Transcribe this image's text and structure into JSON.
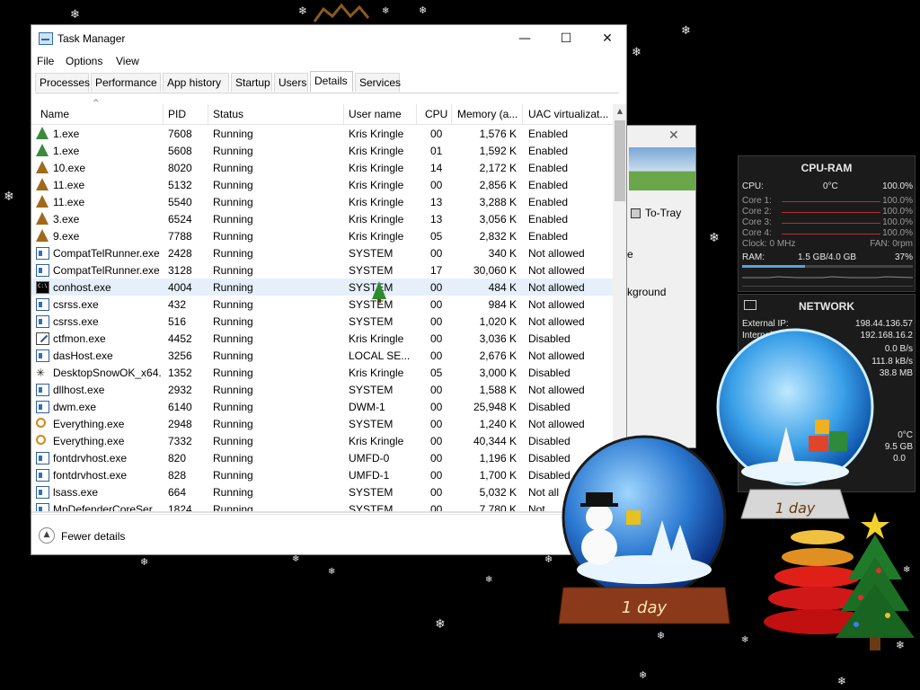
{
  "window": {
    "title": "Task Manager",
    "controls": {
      "minimize": "—",
      "maximize": "☐",
      "close": "✕"
    }
  },
  "menu": [
    "File",
    "Options",
    "View"
  ],
  "tabs": [
    "Processes",
    "Performance",
    "App history",
    "Startup",
    "Users",
    "Details",
    "Services"
  ],
  "active_tab": "Details",
  "columns": [
    "Name",
    "PID",
    "Status",
    "User name",
    "CPU",
    "Memory (a...",
    "UAC virtualizat..."
  ],
  "rows": [
    {
      "icon": "tree-icon",
      "name": "1.exe",
      "pid": "7608",
      "status": "Running",
      "user": "Kris Kringle",
      "cpu": "00",
      "mem": "1,576 K",
      "uac": "Enabled"
    },
    {
      "icon": "tree-icon",
      "name": "1.exe",
      "pid": "5608",
      "status": "Running",
      "user": "Kris Kringle",
      "cpu": "01",
      "mem": "1,592 K",
      "uac": "Enabled"
    },
    {
      "icon": "tree-brown-icon",
      "name": "10.exe",
      "pid": "8020",
      "status": "Running",
      "user": "Kris Kringle",
      "cpu": "14",
      "mem": "2,172 K",
      "uac": "Enabled"
    },
    {
      "icon": "tree-brown-icon",
      "name": "11.exe",
      "pid": "5132",
      "status": "Running",
      "user": "Kris Kringle",
      "cpu": "00",
      "mem": "2,856 K",
      "uac": "Enabled"
    },
    {
      "icon": "tree-brown-icon",
      "name": "11.exe",
      "pid": "5540",
      "status": "Running",
      "user": "Kris Kringle",
      "cpu": "13",
      "mem": "3,288 K",
      "uac": "Enabled"
    },
    {
      "icon": "tree-brown-icon",
      "name": "3.exe",
      "pid": "6524",
      "status": "Running",
      "user": "Kris Kringle",
      "cpu": "13",
      "mem": "3,056 K",
      "uac": "Enabled"
    },
    {
      "icon": "tree-brown-icon",
      "name": "9.exe",
      "pid": "7788",
      "status": "Running",
      "user": "Kris Kringle",
      "cpu": "05",
      "mem": "2,832 K",
      "uac": "Enabled"
    },
    {
      "icon": "app-icon",
      "name": "CompatTelRunner.exe",
      "pid": "2428",
      "status": "Running",
      "user": "SYSTEM",
      "cpu": "00",
      "mem": "340 K",
      "uac": "Not allowed"
    },
    {
      "icon": "app-icon",
      "name": "CompatTelRunner.exe",
      "pid": "3128",
      "status": "Running",
      "user": "SYSTEM",
      "cpu": "17",
      "mem": "30,060 K",
      "uac": "Not allowed"
    },
    {
      "icon": "console-icon",
      "name": "conhost.exe",
      "pid": "4004",
      "status": "Running",
      "user": "SYSTEM",
      "cpu": "00",
      "mem": "484 K",
      "uac": "Not allowed",
      "selected": true
    },
    {
      "icon": "app-icon",
      "name": "csrss.exe",
      "pid": "432",
      "status": "Running",
      "user": "SYSTEM",
      "cpu": "00",
      "mem": "984 K",
      "uac": "Not allowed"
    },
    {
      "icon": "app-icon",
      "name": "csrss.exe",
      "pid": "516",
      "status": "Running",
      "user": "SYSTEM",
      "cpu": "00",
      "mem": "1,020 K",
      "uac": "Not allowed"
    },
    {
      "icon": "pen-icon",
      "name": "ctfmon.exe",
      "pid": "4452",
      "status": "Running",
      "user": "Kris Kringle",
      "cpu": "00",
      "mem": "3,036 K",
      "uac": "Disabled"
    },
    {
      "icon": "app-icon",
      "name": "dasHost.exe",
      "pid": "3256",
      "status": "Running",
      "user": "LOCAL SE...",
      "cpu": "00",
      "mem": "2,676 K",
      "uac": "Not allowed"
    },
    {
      "icon": "snowflake-icon",
      "name": "DesktopSnowOK_x64...",
      "pid": "1352",
      "status": "Running",
      "user": "Kris Kringle",
      "cpu": "05",
      "mem": "3,000 K",
      "uac": "Disabled"
    },
    {
      "icon": "app-icon",
      "name": "dllhost.exe",
      "pid": "2932",
      "status": "Running",
      "user": "SYSTEM",
      "cpu": "00",
      "mem": "1,588 K",
      "uac": "Not allowed"
    },
    {
      "icon": "app-icon",
      "name": "dwm.exe",
      "pid": "6140",
      "status": "Running",
      "user": "DWM-1",
      "cpu": "00",
      "mem": "25,948 K",
      "uac": "Disabled"
    },
    {
      "icon": "search-icon",
      "name": "Everything.exe",
      "pid": "2948",
      "status": "Running",
      "user": "SYSTEM",
      "cpu": "00",
      "mem": "1,240 K",
      "uac": "Not allowed"
    },
    {
      "icon": "search-icon",
      "name": "Everything.exe",
      "pid": "7332",
      "status": "Running",
      "user": "Kris Kringle",
      "cpu": "00",
      "mem": "40,344 K",
      "uac": "Disabled"
    },
    {
      "icon": "app-icon",
      "name": "fontdrvhost.exe",
      "pid": "820",
      "status": "Running",
      "user": "UMFD-0",
      "cpu": "00",
      "mem": "1,196 K",
      "uac": "Disabled"
    },
    {
      "icon": "app-icon",
      "name": "fontdrvhost.exe",
      "pid": "828",
      "status": "Running",
      "user": "UMFD-1",
      "cpu": "00",
      "mem": "1,700 K",
      "uac": "Disabled"
    },
    {
      "icon": "app-icon",
      "name": "lsass.exe",
      "pid": "664",
      "status": "Running",
      "user": "SYSTEM",
      "cpu": "00",
      "mem": "5,032 K",
      "uac": "Not all"
    },
    {
      "icon": "app-icon",
      "name": "MpDefenderCoreSer...",
      "pid": "1824",
      "status": "Running",
      "user": "SYSTEM",
      "cpu": "00",
      "mem": "7,780 K",
      "uac": "Not"
    }
  ],
  "footer": {
    "fewer_details": "Fewer details"
  },
  "background_window": {
    "to_tray": "To-Tray",
    "e": "e",
    "kground": "kground"
  },
  "cpu_ram": {
    "title": "CPU-RAM",
    "cpu_label": "CPU:",
    "cpu_temp": "0°C",
    "cpu_pct": "100.0%",
    "cores": [
      {
        "label": "Core 1:",
        "pct": "100.0%"
      },
      {
        "label": "Core 2:",
        "pct": "100.0%"
      },
      {
        "label": "Core 3:",
        "pct": "100.0%"
      },
      {
        "label": "Core 4:",
        "pct": "100.0%"
      }
    ],
    "clock": "Clock: 0 MHz",
    "fan": "FAN: 0rpm",
    "ram_label": "RAM:",
    "ram_value": "1.5 GB/4.0 GB",
    "ram_pct": "37%",
    "ram_fraction": 0.37
  },
  "network": {
    "title": "NETWORK",
    "external_label": "External IP:",
    "external_ip": "198.44.136.57",
    "internal_label": "Internal IP:",
    "internal_ip": "192.168.16.2",
    "speed1": "0.0 B/s",
    "speed2": "111.8 kB/s",
    "total": "38.8 MB",
    "temp": "0°C",
    "disk": "9.5 GB",
    "disk_sub": "0.0"
  },
  "snow_globes": [
    {
      "label": "1 day"
    },
    {
      "label": "1 day"
    }
  ],
  "colors": {
    "selection": "#e6f0fa",
    "desktop": "#000000",
    "gadget_bg": "#1b1b1b",
    "core_line": "#b23030"
  }
}
